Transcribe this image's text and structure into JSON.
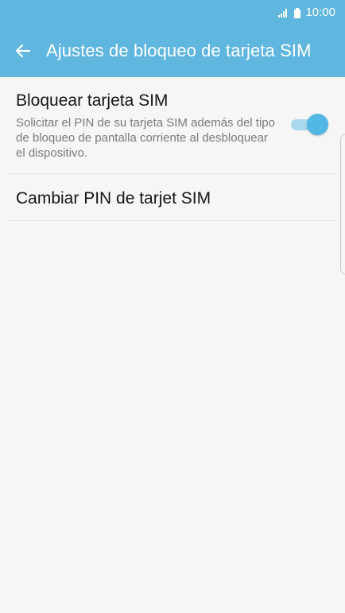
{
  "status_bar": {
    "time": "10:00",
    "icons": [
      "signal-icon",
      "battery-icon"
    ]
  },
  "header": {
    "title": "Ajustes de bloqueo de tarjeta SIM",
    "back_icon": "back-arrow-icon"
  },
  "settings": {
    "lock_sim": {
      "title": "Bloquear tarjeta SIM",
      "description": "Solicitar el PIN de su tarjeta SIM además del tipo de bloqueo de pantalla corriente al desbloquear el dispositivo.",
      "toggle_on": true
    },
    "change_pin": {
      "label": "Cambiar PIN de tarjet SIM"
    }
  },
  "colors": {
    "accent": "#5fb6de",
    "toggle_thumb": "#53b7e6",
    "toggle_track": "#a9d8ee",
    "background": "#f6f6f6"
  }
}
